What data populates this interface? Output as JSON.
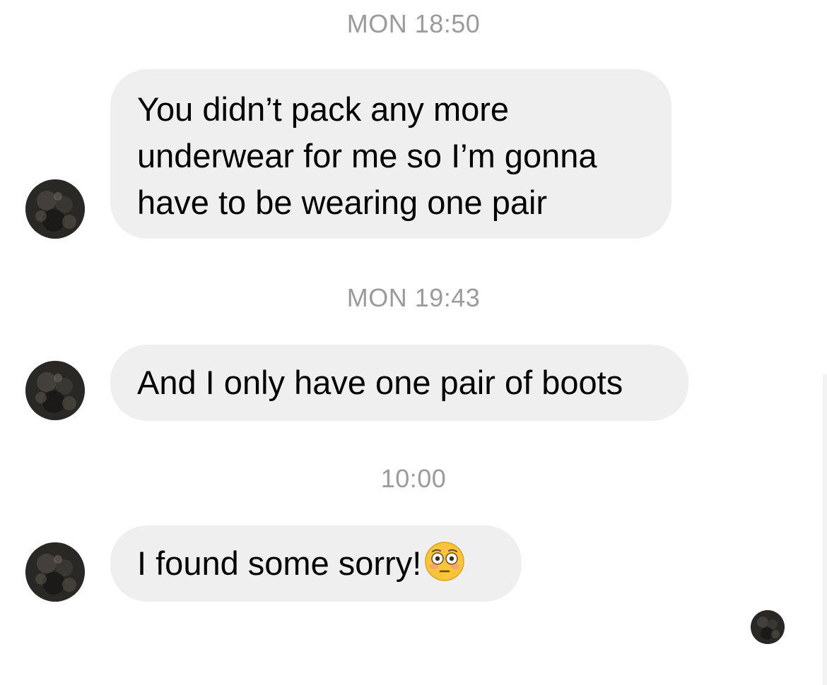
{
  "thread": {
    "messages": [
      {
        "timestamp": "MON 18:50",
        "text": "You didn’t pack any more\nunderwear for me so I’m gonna\nhave to be wearing one pair",
        "sender": "other"
      },
      {
        "timestamp": "MON 19:43",
        "text": "And I only have one pair of boots",
        "sender": "other"
      },
      {
        "timestamp": "10:00",
        "text": "I found some sorry!",
        "emoji": "flushed-face",
        "sender": "other"
      }
    ],
    "read_receipt": "seen-avatar"
  },
  "colors": {
    "bubble_incoming": "#efefef",
    "timestamp_text": "#9b9b9b",
    "message_text": "#000000",
    "background": "#ffffff"
  }
}
